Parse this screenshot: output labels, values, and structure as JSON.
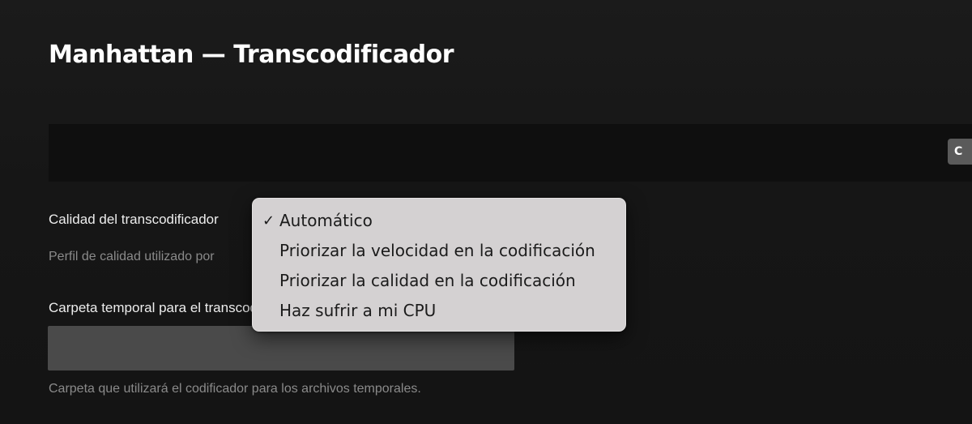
{
  "header": {
    "title": "Manhattan — Transcodificador"
  },
  "banner": {
    "button_label": "C"
  },
  "quality": {
    "label": "Calidad del transcodificador",
    "help": "Perfil de calidad utilizado por",
    "options": [
      {
        "label": "Automático",
        "selected": true
      },
      {
        "label": "Priorizar la velocidad en la codificación",
        "selected": false
      },
      {
        "label": "Priorizar la calidad en la codificación",
        "selected": false
      },
      {
        "label": "Haz sufrir a mi CPU",
        "selected": false
      }
    ],
    "check_glyph": "✓"
  },
  "temp_folder": {
    "label": "Carpeta temporal para el transcodificador",
    "value": "",
    "help": "Carpeta que utilizará el codificador para los archivos temporales."
  },
  "colors": {
    "background": "#171717",
    "banner": "#0f0f0f",
    "menu": "#d4d1d2",
    "input": "#4a4a4a"
  }
}
